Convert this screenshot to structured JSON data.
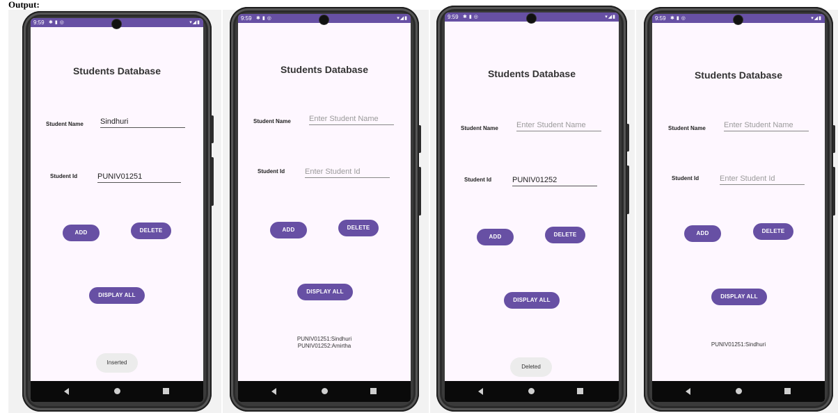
{
  "caption": "Output:",
  "app_title": "Students Database",
  "labels": {
    "name": "Student Name",
    "id": "Student Id"
  },
  "placeholders": {
    "name": "Enter Student Name",
    "id": "Enter Student Id"
  },
  "buttons": {
    "add": "ADD",
    "delete": "DELETE",
    "display_all": "DISPLAY ALL"
  },
  "status_time": "9:59",
  "theme": {
    "primary": "#6750a4",
    "background": "#fef7ff"
  },
  "screens": [
    {
      "name_value": "Sindhuri",
      "id_value": "PUNIV01251",
      "results": [],
      "toast": "Inserted"
    },
    {
      "name_value": "",
      "id_value": "",
      "results": [
        "PUNIV01251:Sindhuri",
        "PUNIV01252:Amirtha"
      ],
      "toast": ""
    },
    {
      "name_value": "",
      "id_value": "PUNIV01252",
      "results": [],
      "toast": "Deleted"
    },
    {
      "name_value": "",
      "id_value": "",
      "results": [
        "PUNIV01251:Sindhuri"
      ],
      "toast": ""
    }
  ]
}
